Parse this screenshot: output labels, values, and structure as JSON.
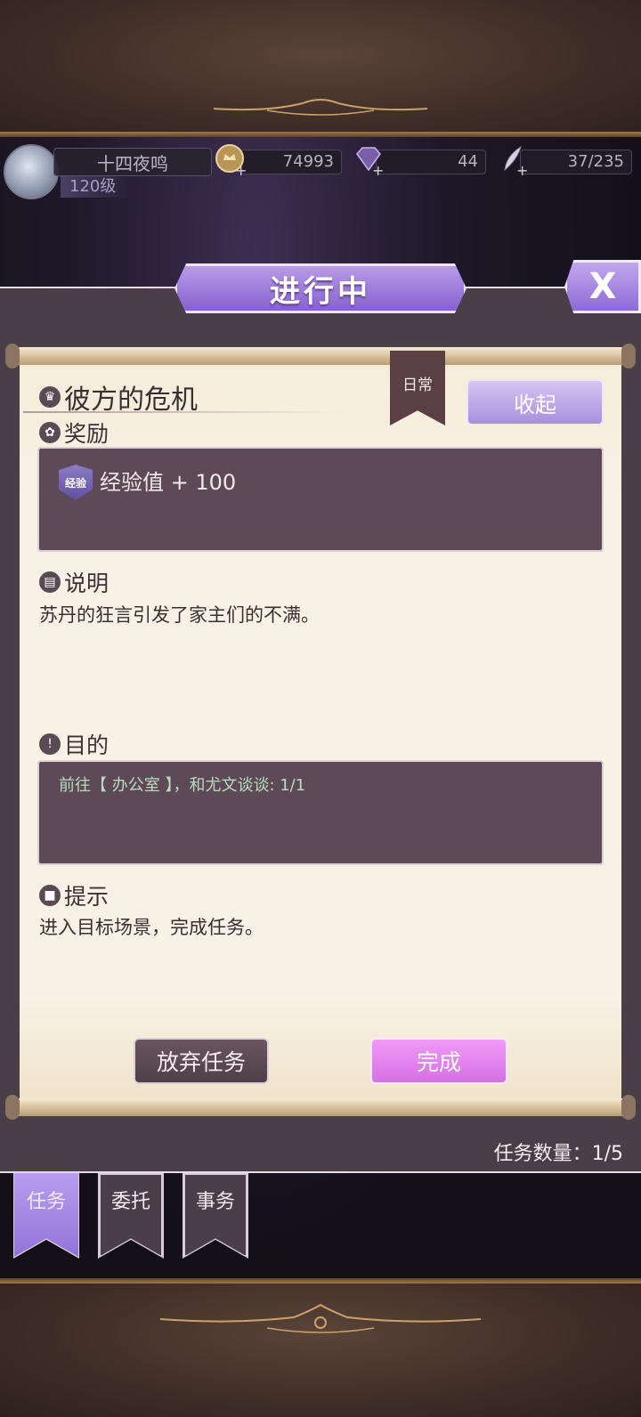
{
  "player": {
    "name": "十四夜鸣",
    "level": "120级"
  },
  "resources": {
    "gold": "74993",
    "gems": "44",
    "stamina": "37/235"
  },
  "panel": {
    "title": "进行中",
    "close_label": "X"
  },
  "quest": {
    "title": "彼方的危机",
    "category": "日常",
    "collapse_label": "收起",
    "reward_heading": "奖励",
    "reward_badge": "经验",
    "reward_text": "经验值 + 100",
    "description_heading": "说明",
    "description": "苏丹的狂言引发了家主们的不满。",
    "goal_heading": "目的",
    "goal_text": "前往【 办公室 】，和尤文谈谈: 1/1",
    "hint_heading": "提示",
    "hint_text": "进入目标场景，完成任务。"
  },
  "actions": {
    "abandon_label": "放弃任务",
    "complete_label": "完成"
  },
  "task_count": "任务数量：1/5",
  "tabs": [
    {
      "label": "任务",
      "active": true
    },
    {
      "label": "委托",
      "active": false
    },
    {
      "label": "事务",
      "active": false
    }
  ],
  "colors": {
    "accent": "#9a7ad9",
    "complete": "#e382ee",
    "panel": "#4a3f48",
    "parchment": "#f8f1e5"
  }
}
